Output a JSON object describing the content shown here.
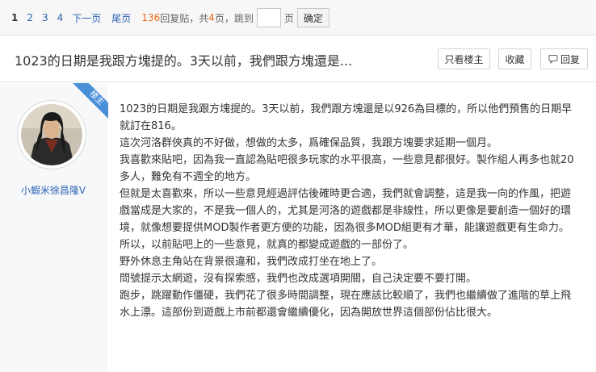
{
  "pager": {
    "pages": [
      "1",
      "2",
      "3",
      "4"
    ],
    "next": "下一页",
    "last": "尾页",
    "reply_count": "136",
    "reply_label": "回复贴，共",
    "page_total": "4",
    "page_unit": "页",
    "jump_label": "，跳到",
    "jump_unit": "页",
    "confirm": "确定"
  },
  "thread": {
    "title": "1023的日期是我跟方塊提的。3天以前，我們跟方塊還是...",
    "btn_only_op": "只看楼主",
    "btn_favorite": "收藏",
    "btn_reply": "回复"
  },
  "post": {
    "badge": "楼主",
    "username": "小蝦米徐昌隆V",
    "paragraphs": [
      "1023的日期是我跟方塊提的。3天以前，我們跟方塊還是以926為目標的，所以他們預售的日期早就訂在816。",
      "這次河洛群俠真的不好做，想做的太多，爲確保品質，我跟方塊要求延期一個月。",
      "我喜歡來貼吧，因為我一直認為貼吧很多玩家的水平很高，一些意見都很好。製作組人再多也就20多人，難免有不週全的地方。",
      "但就是太喜歡來，所以一些意見經過評估後確時更合適，我們就會調整，這是我一向的作風，把遊戲當成是大家的，不是我一個人的，尤其是河洛的遊戲都是非線性，所以更像是要創造一個好的環境，就像想要提供MOD製作者更方便的功能，因為很多MOD組更有才華，能讓遊戲更有生命力。",
      "所以，以前貼吧上的一些意見，就真的都變成遊戲的一部份了。",
      "野外休息主角站在背景很違和，我們改成打坐在地上了。",
      "問號提示太網遊，沒有探索感，我們也改成選項開關，自己決定要不要打開。",
      "跑步，跳躍動作僵硬，我們花了很多時間調整，現在應該比較順了，我們也繼續做了進階的草上飛水上漂。這部份到遊戲上市前都還會繼續優化，因為開放世界這個部份佔比很大。"
    ]
  },
  "colors": {
    "link": "#2d64b3",
    "count": "#e86b1a",
    "badge": "#4a90d9"
  }
}
